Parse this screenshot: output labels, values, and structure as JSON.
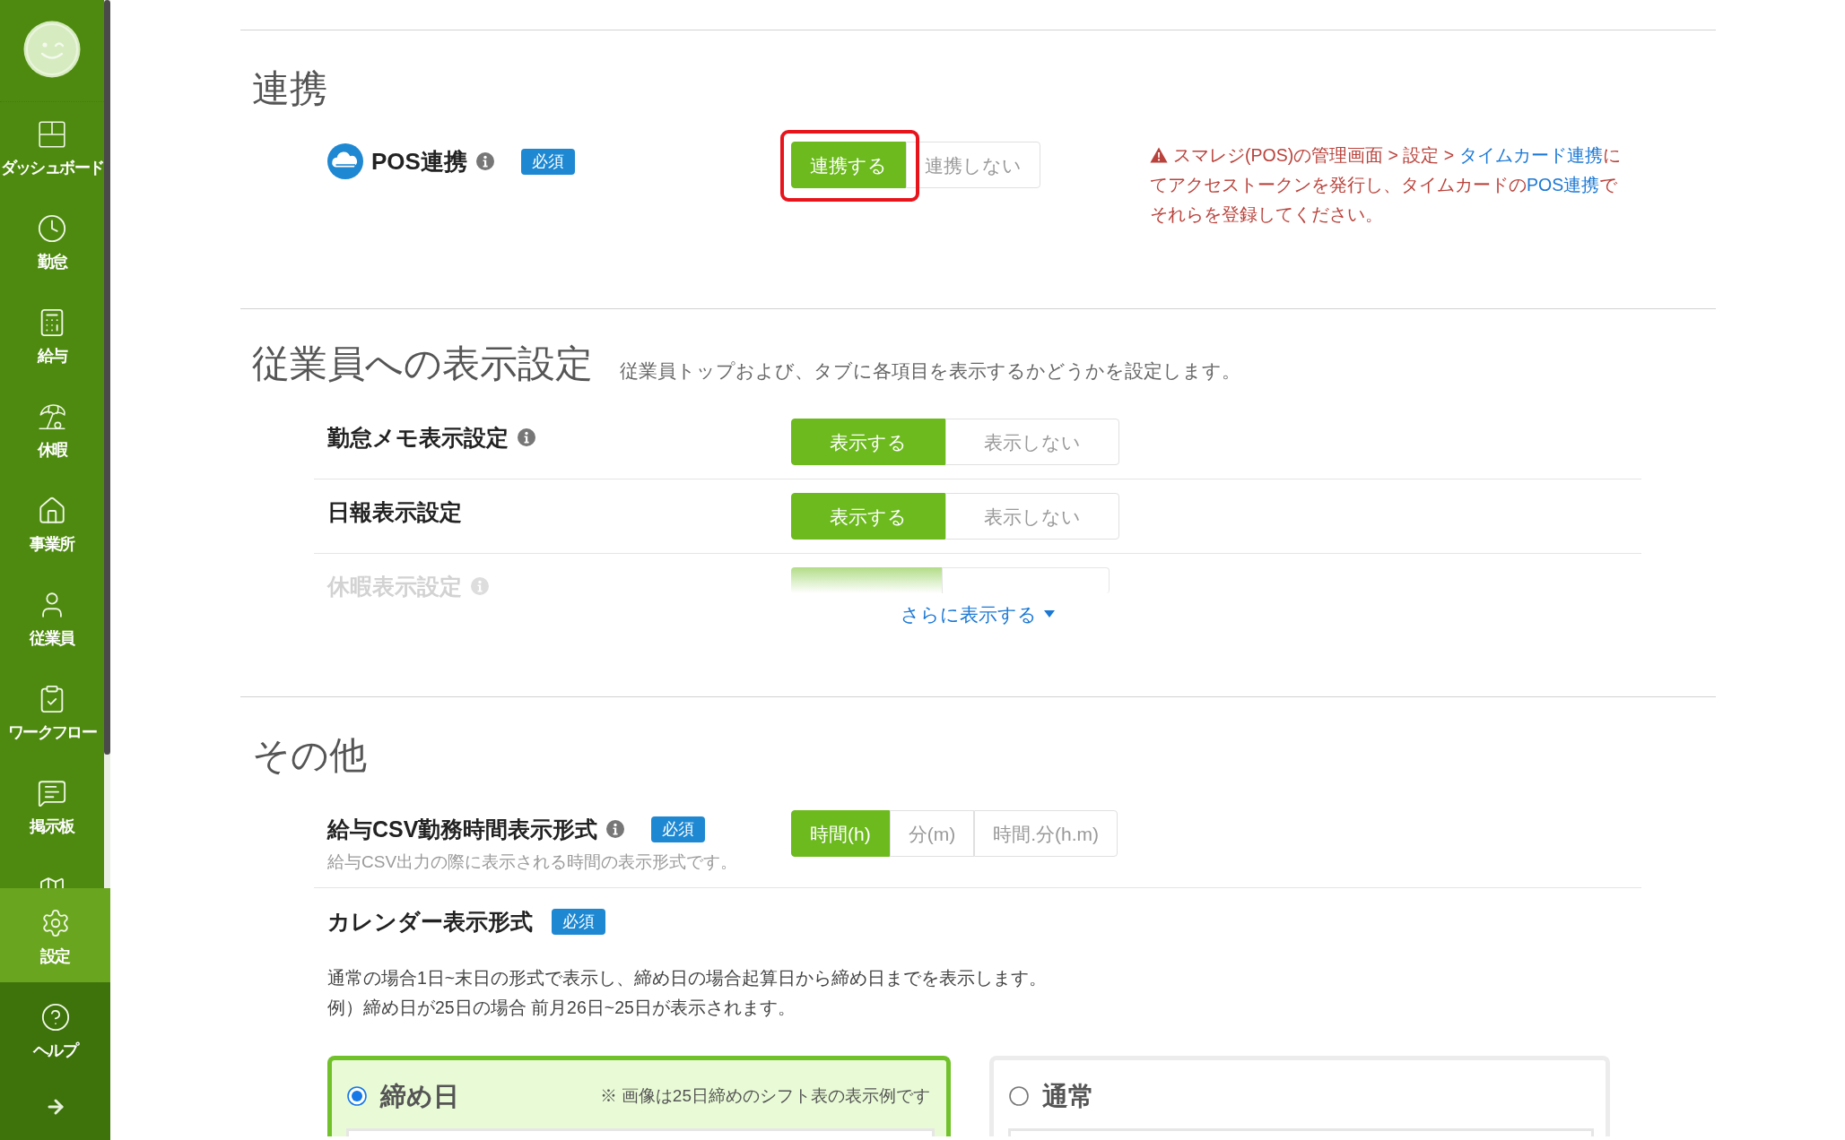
{
  "sidebar": {
    "items": [
      {
        "label": "ダッシュボード",
        "selected": false
      },
      {
        "label": "勤怠",
        "selected": false
      },
      {
        "label": "給与",
        "selected": false
      },
      {
        "label": "休暇",
        "selected": false
      },
      {
        "label": "事業所",
        "selected": false
      },
      {
        "label": "従業員",
        "selected": false
      },
      {
        "label": "ワークフロー",
        "selected": false
      },
      {
        "label": "掲示板",
        "selected": false
      },
      {
        "label": "設定",
        "selected": true
      }
    ],
    "help": {
      "label": "ヘルプ"
    }
  },
  "sections": [
    {
      "title": "連携",
      "rows": [
        {
          "kind": "pos",
          "label": "POS連携",
          "info": true,
          "required": "必須",
          "options": [
            {
              "label": "連携する",
              "selected": true,
              "highlighted": true
            },
            {
              "label": "連携しない",
              "selected": false,
              "highlighted": false
            }
          ],
          "warning": [
            {
              "kind": "text",
              "text": "スマレジ(POS)の管理画面 > 設定 > "
            },
            {
              "kind": "link",
              "text": "タイムカード連携"
            },
            {
              "kind": "text",
              "text": "にてアクセストークンを発行し、タイムカードの"
            },
            {
              "kind": "link",
              "text": "POS連携"
            },
            {
              "kind": "text",
              "text": "でそれらを登録してください。"
            }
          ]
        }
      ]
    },
    {
      "title": "従業員への表示設定",
      "subtitle": "従業員トップおよび、タブに各項目を表示するかどうかを設定します。",
      "rows": [
        {
          "kind": "toggle",
          "label": "勤怠メモ表示設定",
          "info": true,
          "faded": false,
          "options": [
            {
              "label": "表示する",
              "selected": true
            },
            {
              "label": "表示しない",
              "selected": false
            }
          ]
        },
        {
          "kind": "toggle",
          "label": "日報表示設定",
          "info": false,
          "faded": false,
          "options": [
            {
              "label": "表示する",
              "selected": true
            },
            {
              "label": "表示しない",
              "selected": false
            }
          ]
        },
        {
          "kind": "toggle",
          "label": "休暇表示設定",
          "info": true,
          "faded": true,
          "options": [
            {
              "selected": true
            },
            {
              "selected": false
            }
          ]
        }
      ],
      "more_link": "さらに表示する"
    },
    {
      "title": "その他",
      "rows": [
        {
          "kind": "format",
          "label": "給与CSV勤務時間表示形式",
          "info": true,
          "required": "必須",
          "hint": "給与CSV出力の際に表示される時間の表示形式です。",
          "options": [
            {
              "label": "時間(h)",
              "selected": true
            },
            {
              "label": "分(m)",
              "selected": false
            },
            {
              "label": "時間.分(h.m)",
              "selected": false
            }
          ]
        },
        {
          "kind": "calendar",
          "label": "カレンダー表示形式",
          "required": "必須",
          "description": [
            "通常の場合1日~末日の形式で表示し、締め日の場合起算日から締め日までを表示します。",
            "例）締め日が25日の場合 前月26日~25日が表示されます。"
          ],
          "cards": [
            {
              "label": "締め日",
              "note": "※ 画像は25日締めのシフト表の表示例です",
              "selected": true
            },
            {
              "label": "通常",
              "selected": false
            }
          ]
        }
      ]
    }
  ]
}
